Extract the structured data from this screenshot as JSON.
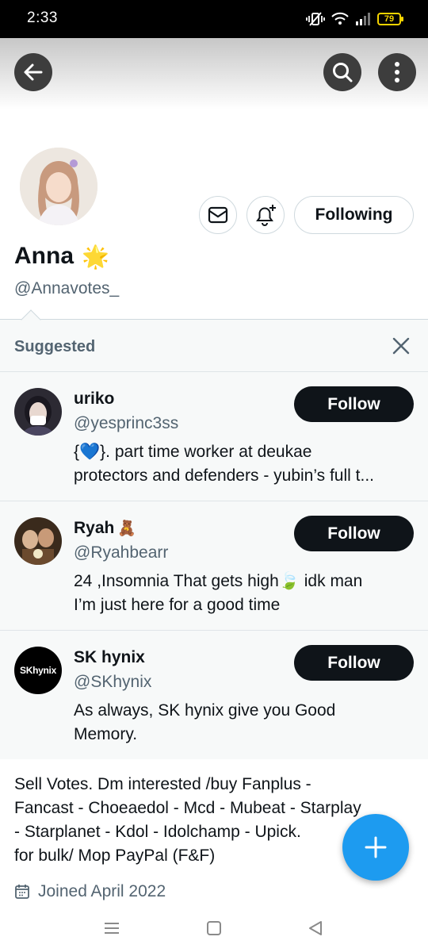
{
  "status_bar": {
    "time": "2:33",
    "battery": "79"
  },
  "header": {
    "back_icon": "arrow-left-icon",
    "search_icon": "search-icon",
    "more_icon": "more-vertical-icon"
  },
  "profile": {
    "display_name": "Anna",
    "name_emoji": "🌟",
    "handle": "@Annavotes_",
    "following_label": "Following",
    "message_icon": "mail-icon",
    "notify_icon": "bell-plus-icon"
  },
  "suggested": {
    "title": "Suggested",
    "items": [
      {
        "name": "uriko",
        "name_emoji": "",
        "handle": "@yesprinc3ss",
        "bio_lines": [
          "{💙}. part time worker at deukae",
          "protectors and defenders - yubin’s full t..."
        ],
        "follow_label": "Follow"
      },
      {
        "name": "Ryah",
        "name_emoji": "🧸",
        "handle": "@Ryahbearr",
        "bio_lines": [
          "24 ,Insomnia That gets high🍃 idk man",
          "I’m just here for a good time"
        ],
        "follow_label": "Follow"
      },
      {
        "name": "SK hynix",
        "name_emoji": "",
        "handle": "@SKhynix",
        "bio_lines": [
          "As always, SK hynix give you Good",
          "Memory."
        ],
        "follow_label": "Follow",
        "avatar_text": "SKhynix"
      }
    ]
  },
  "bio": {
    "lines": [
      "Sell Votes. Dm interested /buy Fanplus -",
      "Fancast - Choeaedol - Mcd - Mubeat - Starplay",
      "- Starplanet - Kdol - Idolchamp - Upick. ",
      "for bulk/ Mop PayPal (F&F)"
    ]
  },
  "joined": {
    "text": "Joined April 2022"
  },
  "colors": {
    "accent": "#1d9bf0",
    "text": "#0f1419",
    "muted": "#536471",
    "border": "#cfd9de"
  }
}
